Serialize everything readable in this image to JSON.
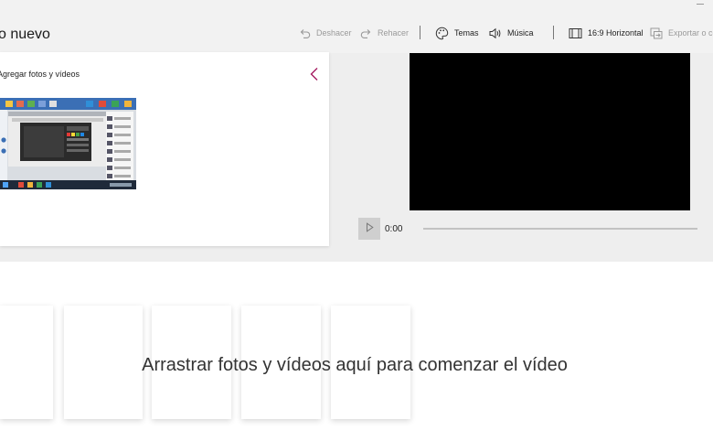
{
  "window": {
    "title": "o nuevo"
  },
  "toolbar": {
    "undo_label": "Deshacer",
    "redo_label": "Rehacer",
    "themes_label": "Temas",
    "music_label": "Música",
    "aspect_label": "16:9 Horizontal",
    "export_label": "Exportar o co"
  },
  "library": {
    "title": "Agregar fotos y vídeos"
  },
  "preview": {
    "time": "0:00",
    "progress": 0
  },
  "storyboard": {
    "hint": "Arrastrar fotos y vídeos aquí para comenzar el vídeo"
  },
  "colors": {
    "accent": "#a4195f",
    "video_bg": "#000000",
    "disabled_text": "#9a9a9a"
  },
  "icons": [
    "undo-icon",
    "redo-icon",
    "palette-icon",
    "speaker-icon",
    "aspect-ratio-icon",
    "export-icon",
    "chevron-left-icon",
    "play-icon"
  ]
}
